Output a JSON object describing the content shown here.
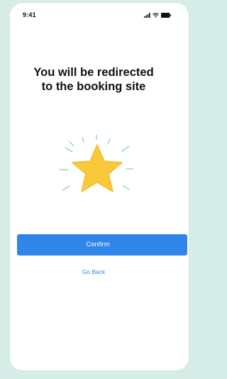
{
  "status_bar": {
    "time": "9:41",
    "icons": [
      "signal-icon",
      "wifi-icon",
      "battery-icon"
    ]
  },
  "headline": {
    "line1": "You will be redirected",
    "line2": "to the booking site"
  },
  "illustration": {
    "icon": "star-icon",
    "star_color": "#f9c93c",
    "spark_color": "#7fd0ad"
  },
  "actions": {
    "confirm_label": "Confirm",
    "go_back_label": "Go Back"
  },
  "colors": {
    "background": "#d7ede7",
    "primary": "#2f86e8"
  }
}
